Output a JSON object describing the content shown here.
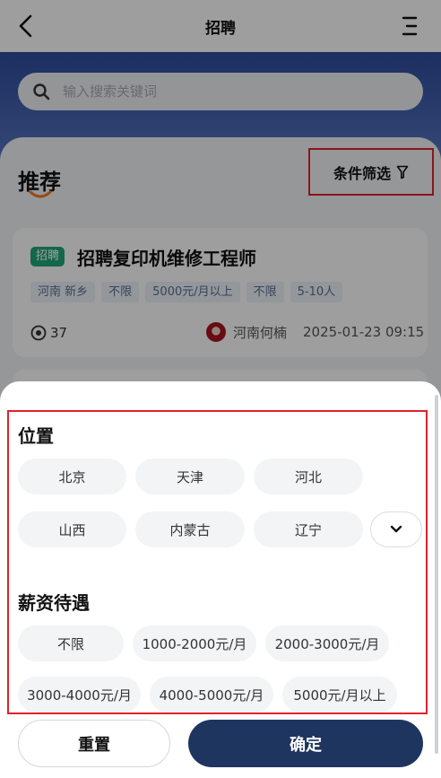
{
  "nav": {
    "title": "招聘"
  },
  "search": {
    "placeholder": "输入搜索关键词"
  },
  "recommend": {
    "title": "推荐",
    "filter_label": "条件筛选"
  },
  "job": {
    "badge": "招聘",
    "title": "招聘复印机维修工程师",
    "tags": [
      "河南 新乡",
      "不限",
      "5000元/月以上",
      "不限",
      "5-10人"
    ],
    "views": "37",
    "author": "河南何楠",
    "time": "2025-01-23 09:15"
  },
  "filter": {
    "location_title": "位置",
    "locations": [
      "北京",
      "天津",
      "河北",
      "山西",
      "内蒙古",
      "辽宁"
    ],
    "salary_title": "薪资待遇",
    "salaries": [
      "不限",
      "1000-2000元/月",
      "2000-3000元/月",
      "3000-4000元/月",
      "4000-5000元/月",
      "5000元/月以上"
    ]
  },
  "actions": {
    "reset": "重置",
    "confirm": "确定"
  },
  "colors": {
    "brand_blue": "#2d4d9c",
    "confirm": "#1e3560",
    "badge": "#1fa77a",
    "highlight": "#e0222a"
  }
}
